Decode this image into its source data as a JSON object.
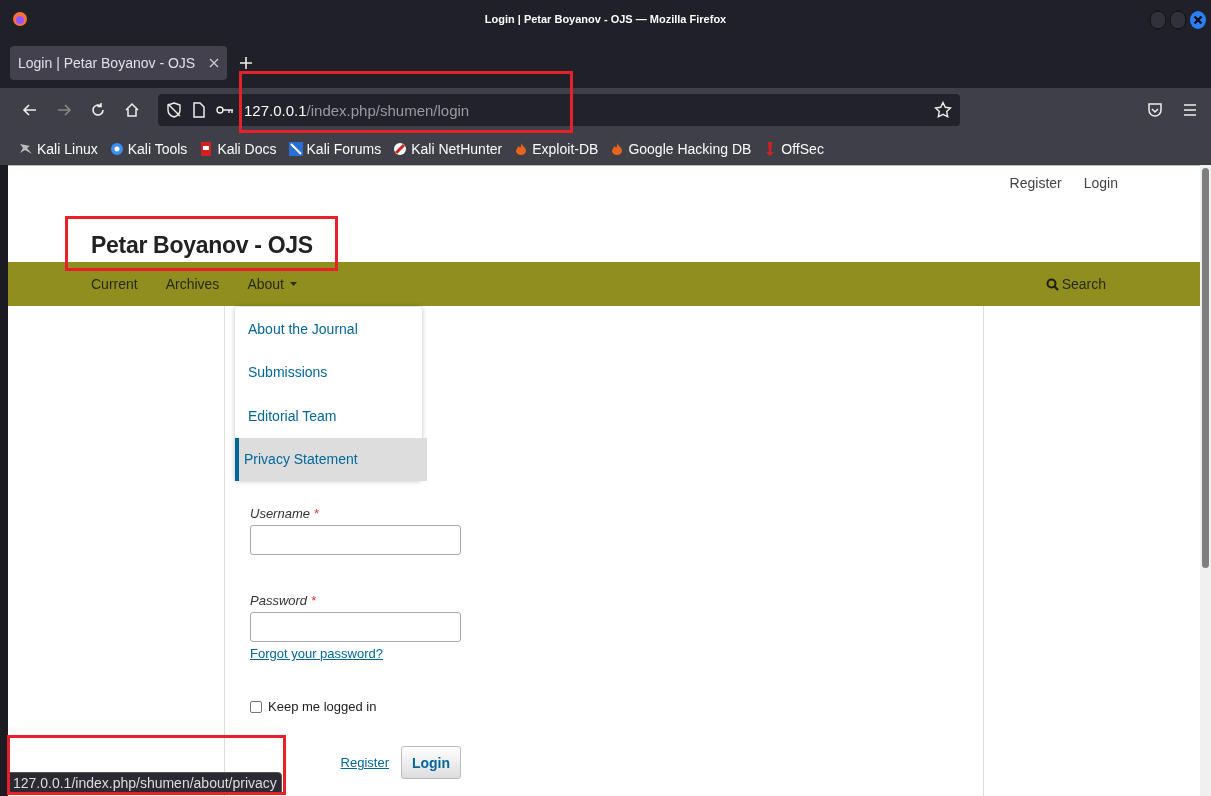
{
  "window": {
    "title": "Login | Petar Boyanov - OJS — Mozilla Firefox"
  },
  "tabs": [
    {
      "label": "Login | Petar Boyanov - OJS",
      "selected": true
    }
  ],
  "address_bar": {
    "host": "127.0.0.1",
    "path": "/index.php/shumen/login"
  },
  "bookmarks": [
    {
      "label": "Kali Linux",
      "kind": "dragon"
    },
    {
      "label": "Kali Tools",
      "kind": "tools"
    },
    {
      "label": "Kali Docs",
      "kind": "docs"
    },
    {
      "label": "Kali Forums",
      "kind": "forums"
    },
    {
      "label": "Kali NetHunter",
      "kind": "nethunter"
    },
    {
      "label": "Exploit-DB",
      "kind": "flame"
    },
    {
      "label": "Google Hacking DB",
      "kind": "flame"
    },
    {
      "label": "OffSec",
      "kind": "offsec"
    }
  ],
  "page": {
    "user_links": [
      "Register",
      "Login"
    ],
    "site_title": "Petar Boyanov - OJS",
    "nav": [
      {
        "label": "Current",
        "kind": "link"
      },
      {
        "label": "Archives",
        "kind": "link"
      },
      {
        "label": "About",
        "kind": "dropdown"
      }
    ],
    "search": "Search",
    "dropdown": [
      {
        "label": "About the Journal",
        "selected": false
      },
      {
        "label": "Submissions",
        "selected": false
      },
      {
        "label": "Editorial Team",
        "selected": false
      },
      {
        "label": "Privacy Statement",
        "selected": true
      }
    ],
    "form": {
      "fields": [
        {
          "label": "Username",
          "required_mark": "*",
          "kind": "text"
        },
        {
          "label": "Password",
          "required_mark": "*",
          "kind": "password"
        }
      ],
      "forgot_link": "Forgot your password?",
      "remember": {
        "label": "Keep me logged in",
        "checked": false
      },
      "register_link": "Register",
      "login_button": "Login"
    }
  },
  "status_tooltip": "127.0.0.1/index.php/shumen/about/privacy"
}
